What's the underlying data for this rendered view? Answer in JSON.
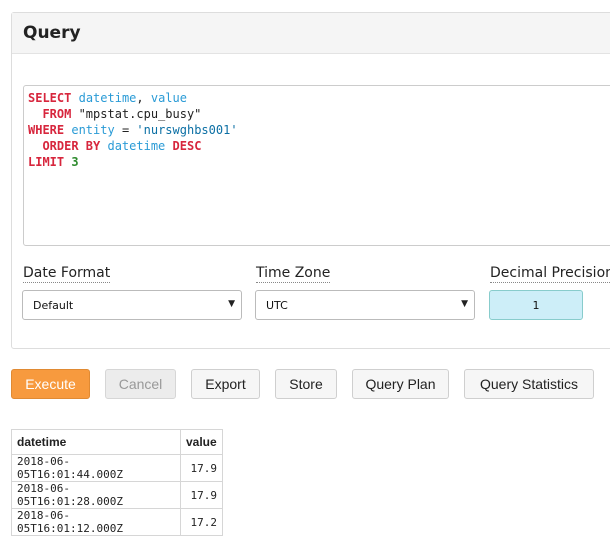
{
  "panel": {
    "title": "Query"
  },
  "editor": {
    "lines": [
      [
        {
          "t": "kw",
          "v": "SELECT"
        },
        {
          "t": "plain",
          "v": " "
        },
        {
          "t": "id",
          "v": "datetime"
        },
        {
          "t": "plain",
          "v": ", "
        },
        {
          "t": "id",
          "v": "value"
        }
      ],
      [
        {
          "t": "plain",
          "v": "  "
        },
        {
          "t": "kw",
          "v": "FROM"
        },
        {
          "t": "plain",
          "v": " \"mpstat.cpu_busy\""
        }
      ],
      [
        {
          "t": "kw",
          "v": "WHERE"
        },
        {
          "t": "plain",
          "v": " "
        },
        {
          "t": "id",
          "v": "entity"
        },
        {
          "t": "plain",
          "v": " = "
        },
        {
          "t": "str",
          "v": "'nurswghbs001'"
        }
      ],
      [
        {
          "t": "plain",
          "v": "  "
        },
        {
          "t": "kw",
          "v": "ORDER BY"
        },
        {
          "t": "plain",
          "v": " "
        },
        {
          "t": "id",
          "v": "datetime"
        },
        {
          "t": "plain",
          "v": " "
        },
        {
          "t": "kw",
          "v": "DESC"
        }
      ],
      [
        {
          "t": "kw",
          "v": "LIMIT"
        },
        {
          "t": "plain",
          "v": " "
        },
        {
          "t": "num",
          "v": "3"
        }
      ]
    ]
  },
  "options": {
    "date_format": {
      "label": "Date Format",
      "value": "Default"
    },
    "time_zone": {
      "label": "Time Zone",
      "value": "UTC"
    },
    "precision": {
      "label": "Decimal Precision",
      "value": "1"
    }
  },
  "toolbar": {
    "execute": "Execute",
    "cancel": "Cancel",
    "export": "Export",
    "store": "Store",
    "query_plan": "Query Plan",
    "query_statistics": "Query Statistics"
  },
  "results": {
    "columns": [
      "datetime",
      "value"
    ],
    "rows": [
      [
        "2018-06-05T16:01:44.000Z",
        "17.9"
      ],
      [
        "2018-06-05T16:01:28.000Z",
        "17.9"
      ],
      [
        "2018-06-05T16:01:12.000Z",
        "17.2"
      ]
    ]
  },
  "colors": {
    "execute_bg": "#f79a3e",
    "keyword": "#d7263d",
    "identifier": "#2a9bd6",
    "precision_bg": "#cdeef8"
  }
}
